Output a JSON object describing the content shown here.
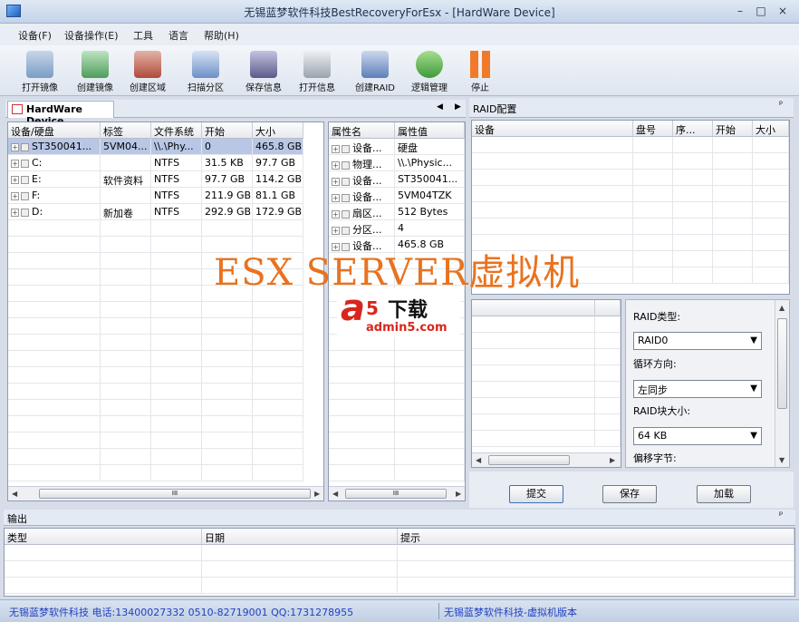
{
  "window": {
    "title": "无锡蓝梦软件科技BestRecoveryForEsx - [HardWare Device]",
    "minimize": "–",
    "restore": "□",
    "close": "×"
  },
  "menu": [
    "设备(F)",
    "设备操作(E)",
    "工具",
    "语言",
    "帮助(H)"
  ],
  "toolbar": [
    {
      "label": "打开镜像",
      "icon": "open-image-icon",
      "color": "#7a9cc4"
    },
    {
      "label": "创建镜像",
      "icon": "create-image-icon",
      "color": "#4f9d5b"
    },
    {
      "label": "创建区域",
      "icon": "create-region-icon",
      "color": "#b04a3a"
    },
    {
      "label": "扫描分区",
      "icon": "scan-partition-icon",
      "color": "#6c8fc7"
    },
    {
      "label": "保存信息",
      "icon": "save-info-icon",
      "color": "#5a5a8a"
    },
    {
      "label": "打开信息",
      "icon": "open-info-icon",
      "color": "#9aa3ad"
    },
    {
      "label": "创建RAID",
      "icon": "create-raid-icon",
      "color": "#5d7fb8"
    },
    {
      "label": "逻辑管理",
      "icon": "logic-manage-icon",
      "color": "#3f9a3a"
    },
    {
      "label": "停止",
      "icon": "stop-icon",
      "color": "#f07a2a"
    }
  ],
  "device_tab": {
    "title": "HardWare Device",
    "prev": "◀",
    "next": "▶"
  },
  "device_grid": {
    "columns": [
      "设备/硬盘",
      "标签",
      "文件系统",
      "开始",
      "大小"
    ],
    "rows": [
      [
        "ST350041...",
        "5VM04...",
        "\\\\.\\Phy...",
        "0",
        "465.8 GB"
      ],
      [
        "C:",
        "",
        "NTFS",
        "31.5 KB",
        "97.7 GB"
      ],
      [
        "E:",
        "软件资料",
        "NTFS",
        "97.7 GB",
        "114.2 GB"
      ],
      [
        "F:",
        "",
        "NTFS",
        "211.9 GB",
        "81.1 GB"
      ],
      [
        "D:",
        "新加卷",
        "NTFS",
        "292.9 GB",
        "172.9 GB"
      ]
    ],
    "scroll_mark": "III"
  },
  "prop_grid": {
    "columns": [
      "属性名",
      "属性值"
    ],
    "rows": [
      [
        "设备...",
        "硬盘"
      ],
      [
        "物理...",
        "\\\\.\\Physic..."
      ],
      [
        "设备...",
        "ST350041..."
      ],
      [
        "设备...",
        "5VM04TZK"
      ],
      [
        "扇区...",
        "512 Bytes"
      ],
      [
        "分区...",
        "4"
      ],
      [
        "设备...",
        "465.8 GB"
      ]
    ],
    "scroll_mark": "III"
  },
  "raid": {
    "title": "RAID配置",
    "pin": "ᵖ",
    "columns": [
      "设备",
      "盘号",
      "序...",
      "开始",
      "大小"
    ],
    "type_label": "RAID类型:",
    "type_value": "RAID0",
    "dir_label": "循环方向:",
    "dir_value": "左同步",
    "block_label": "RAID块大小:",
    "block_value": "64 KB",
    "offset_label": "偏移字节:",
    "submit": "提交",
    "save": "保存",
    "load": "加载"
  },
  "output": {
    "title": "输出",
    "pin": "ᵖ",
    "columns": [
      "类型",
      "日期",
      "提示"
    ]
  },
  "watermark": {
    "text": "ESX SERVER虚拟机",
    "logo_a": "a",
    "logo_5": "5",
    "logo_dl": "下载",
    "logo_url": "admin5.com"
  },
  "status": {
    "left": "无锡蓝梦软件科技 电话:13400027332 0510-82719001 QQ:1731278955",
    "right": "无锡蓝梦软件科技-虚拟机版本"
  },
  "colors": {
    "accent": "#2240c0",
    "watermark": "#e8731f",
    "selection": "#b9c7e6"
  }
}
